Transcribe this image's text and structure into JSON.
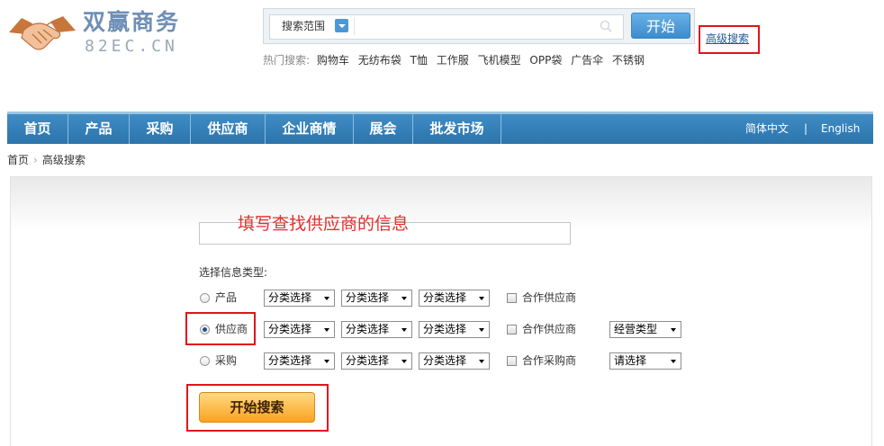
{
  "header": {
    "logo_cn": "双赢商务",
    "logo_en": "82EC.CN",
    "search": {
      "scope_label": "搜索范围",
      "query": "",
      "submit_label": "开始"
    },
    "advanced_search_link": "高级搜索",
    "hot": {
      "label": "热门搜索:",
      "items": [
        "购物车",
        "无纺布袋",
        "T恤",
        "工作服",
        "飞机模型",
        "OPP袋",
        "广告伞",
        "不锈钢"
      ]
    }
  },
  "nav": {
    "items": [
      "首页",
      "产品",
      "采购",
      "供应商",
      "企业商情",
      "展会",
      "批发市场"
    ],
    "lang": {
      "zh": "简体中文",
      "sep": "|",
      "en": "English"
    }
  },
  "breadcrumb": {
    "home": "首页",
    "current": "高级搜索"
  },
  "form": {
    "keyword_hint": "填写查找供应商的信息",
    "keyword_value": "",
    "type_label": "选择信息类型:",
    "rows": [
      {
        "radio_label": "产品",
        "checked": false,
        "selects": [
          "分类选择",
          "分类选择",
          "分类选择"
        ],
        "checkbox_label": "合作供应商",
        "extra_select": ""
      },
      {
        "radio_label": "供应商",
        "checked": true,
        "selects": [
          "分类选择",
          "分类选择",
          "分类选择"
        ],
        "checkbox_label": "合作供应商",
        "extra_select": "经营类型"
      },
      {
        "radio_label": "采购",
        "checked": false,
        "selects": [
          "分类选择",
          "分类选择",
          "分类选择"
        ],
        "checkbox_label": "合作采购商",
        "extra_select": "请选择"
      }
    ],
    "submit_label": "开始搜索"
  },
  "colors": {
    "nav_bg": "#3380b8",
    "link": "#1e5a9c",
    "highlight": "#e0141c",
    "hint_text": "#e62e2e",
    "button_orange": "#fba31f"
  },
  "icons": [
    "handshake-logo-icon",
    "dropdown-arrow-icon",
    "search-magnifier-icon",
    "breadcrumb-arrow-icon"
  ]
}
